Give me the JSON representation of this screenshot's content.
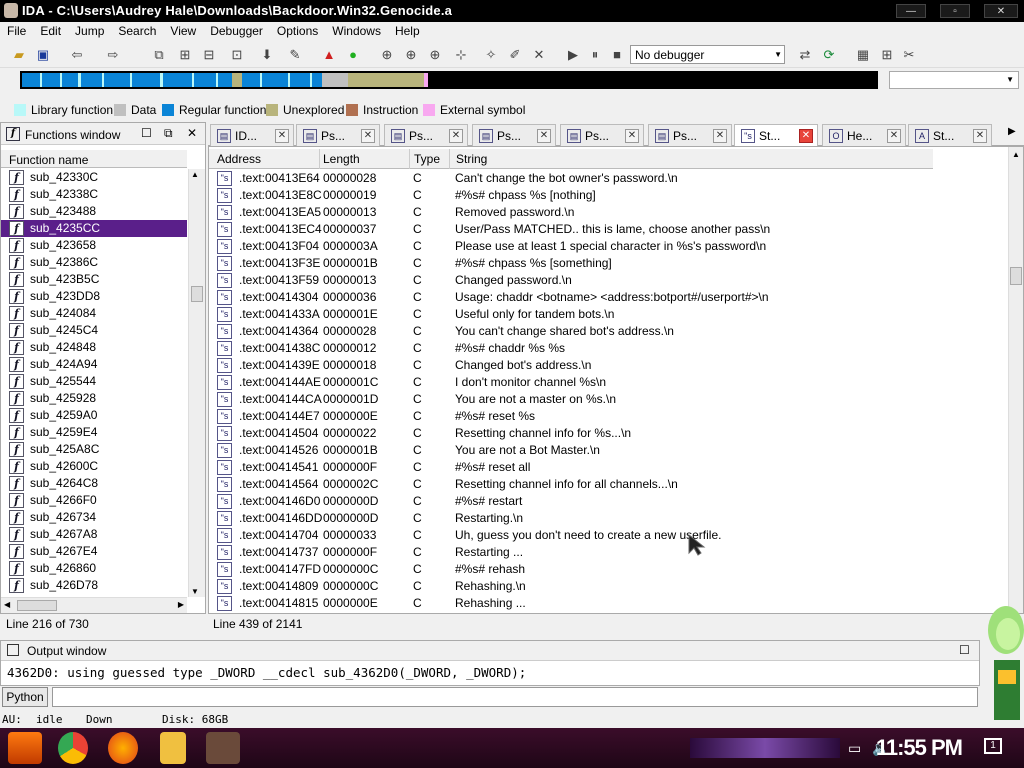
{
  "window": {
    "title": "IDA - C:\\Users\\Audrey Hale\\Downloads\\Backdoor.Win32.Genocide.a"
  },
  "menu": [
    "File",
    "Edit",
    "Jump",
    "Search",
    "View",
    "Debugger",
    "Options",
    "Windows",
    "Help"
  ],
  "toolbar": {
    "debugger_select": "No debugger"
  },
  "legend": [
    {
      "label": "Library function",
      "color": "#b8f8f8"
    },
    {
      "label": "Data",
      "color": "#c0c0c0"
    },
    {
      "label": "Regular function",
      "color": "#0a84d6"
    },
    {
      "label": "Unexplored",
      "color": "#b8b47c"
    },
    {
      "label": "Instruction",
      "color": "#b07050"
    },
    {
      "label": "External symbol",
      "color": "#f8a8f0"
    }
  ],
  "functions_window": {
    "title": "Functions window",
    "column": "Function name",
    "items": [
      "sub_42330C",
      "sub_42338C",
      "sub_423488",
      "sub_4235CC",
      "sub_423658",
      "sub_42386C",
      "sub_423B5C",
      "sub_423DD8",
      "sub_424084",
      "sub_4245C4",
      "sub_424848",
      "sub_424A94",
      "sub_425544",
      "sub_425928",
      "sub_4259A0",
      "sub_4259E4",
      "sub_425A8C",
      "sub_42600C",
      "sub_4264C8",
      "sub_4266F0",
      "sub_426734",
      "sub_4267A8",
      "sub_4267E4",
      "sub_426860",
      "sub_426D78"
    ],
    "selected_index": 3,
    "status": "Line 216 of 730"
  },
  "tabs": [
    {
      "label": "ID...",
      "icon": "view-icon"
    },
    {
      "label": "Ps...",
      "icon": "pseudocode-icon"
    },
    {
      "label": "Ps...",
      "icon": "pseudocode-icon"
    },
    {
      "label": "Ps...",
      "icon": "pseudocode-icon"
    },
    {
      "label": "Ps...",
      "icon": "pseudocode-icon"
    },
    {
      "label": "Ps...",
      "icon": "pseudocode-icon"
    },
    {
      "label": "St...",
      "icon": "strings-icon",
      "active": true
    },
    {
      "label": "He...",
      "icon": "hex-icon"
    },
    {
      "label": "St...",
      "icon": "structs-icon"
    }
  ],
  "strings_window": {
    "columns": [
      "Address",
      "Length",
      "Type",
      "String"
    ],
    "rows": [
      [
        ".text:00413E64",
        "00000028",
        "C",
        "Can't change the bot owner's password.\\n"
      ],
      [
        ".text:00413E8C",
        "00000019",
        "C",
        "#%s# chpass %s [nothing]"
      ],
      [
        ".text:00413EA5",
        "00000013",
        "C",
        "Removed password.\\n"
      ],
      [
        ".text:00413EC4",
        "00000037",
        "C",
        "User/Pass MATCHED.. this is lame, choose another pass\\n"
      ],
      [
        ".text:00413F04",
        "0000003A",
        "C",
        "Please use at least 1 special character in %s's password\\n"
      ],
      [
        ".text:00413F3E",
        "0000001B",
        "C",
        "#%s# chpass %s [something]"
      ],
      [
        ".text:00413F59",
        "00000013",
        "C",
        "Changed password.\\n"
      ],
      [
        ".text:00414304",
        "00000036",
        "C",
        "Usage: chaddr <botname> <address:botport#/userport#>\\n"
      ],
      [
        ".text:0041433A",
        "0000001E",
        "C",
        "Useful only for tandem bots.\\n"
      ],
      [
        ".text:00414364",
        "00000028",
        "C",
        "You can't change shared bot's address.\\n"
      ],
      [
        ".text:0041438C",
        "00000012",
        "C",
        "#%s# chaddr %s %s"
      ],
      [
        ".text:0041439E",
        "00000018",
        "C",
        "Changed bot's address.\\n"
      ],
      [
        ".text:004144AE",
        "0000001C",
        "C",
        "I don't monitor channel %s\\n"
      ],
      [
        ".text:004144CA",
        "0000001D",
        "C",
        "You are not a master on %s.\\n"
      ],
      [
        ".text:004144E7",
        "0000000E",
        "C",
        "#%s# reset %s"
      ],
      [
        ".text:00414504",
        "00000022",
        "C",
        "Resetting channel info for %s...\\n"
      ],
      [
        ".text:00414526",
        "0000001B",
        "C",
        "You are not a Bot Master.\\n"
      ],
      [
        ".text:00414541",
        "0000000F",
        "C",
        "#%s# reset all"
      ],
      [
        ".text:00414564",
        "0000002C",
        "C",
        "Resetting channel info for all channels...\\n"
      ],
      [
        ".text:004146D0",
        "0000000D",
        "C",
        "#%s# restart"
      ],
      [
        ".text:004146DD",
        "0000000D",
        "C",
        "Restarting.\\n"
      ],
      [
        ".text:00414704",
        "00000033",
        "C",
        "Uh, guess you don't need to create a new userfile."
      ],
      [
        ".text:00414737",
        "0000000F",
        "C",
        "Restarting ..."
      ],
      [
        ".text:004147FD",
        "0000000C",
        "C",
        "#%s# rehash"
      ],
      [
        ".text:00414809",
        "0000000C",
        "C",
        "Rehashing.\\n"
      ],
      [
        ".text:00414815",
        "0000000E",
        "C",
        "Rehashing ..."
      ]
    ],
    "status": "Line 439 of 2141"
  },
  "output_window": {
    "title": "Output window",
    "line": "4362D0: using guessed type _DWORD __cdecl sub_4362D0(_DWORD, _DWORD);"
  },
  "python": {
    "label": "Python"
  },
  "statusline": {
    "au_label": "AU:",
    "au_state": "idle",
    "direction": "Down",
    "disk": "Disk: 68GB"
  },
  "taskbar": {
    "clock": "11:55 PM",
    "notification_count": "1"
  }
}
